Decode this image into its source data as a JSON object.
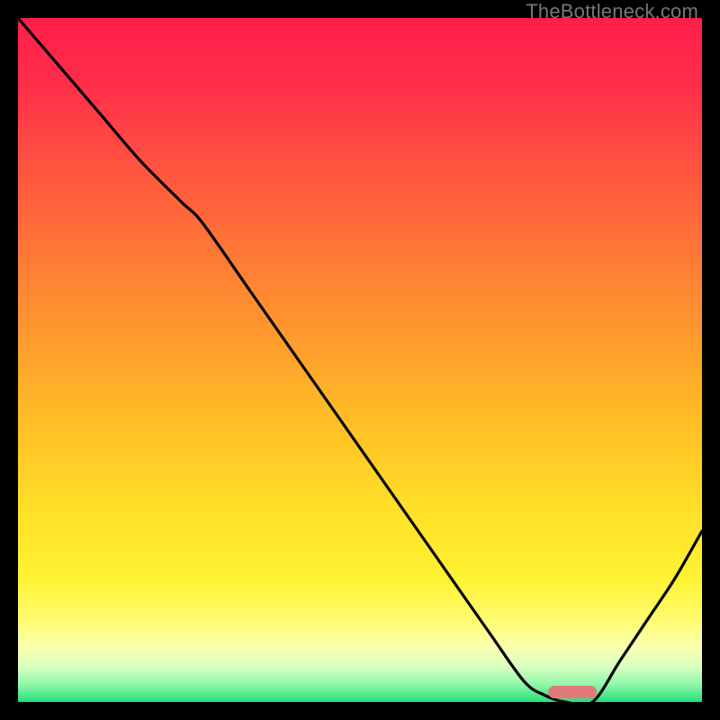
{
  "watermark": "TheBottleneck.com",
  "gradient_stops": [
    {
      "offset": 0.0,
      "color": "#ff1e4a"
    },
    {
      "offset": 0.1,
      "color": "#ff2f49"
    },
    {
      "offset": 0.22,
      "color": "#ff5440"
    },
    {
      "offset": 0.35,
      "color": "#ff7a36"
    },
    {
      "offset": 0.48,
      "color": "#ff9e2c"
    },
    {
      "offset": 0.6,
      "color": "#ffc126"
    },
    {
      "offset": 0.72,
      "color": "#ffe028"
    },
    {
      "offset": 0.82,
      "color": "#fff232"
    },
    {
      "offset": 0.88,
      "color": "#fffb70"
    },
    {
      "offset": 0.92,
      "color": "#fbffb0"
    },
    {
      "offset": 0.95,
      "color": "#d6ffc0"
    },
    {
      "offset": 0.975,
      "color": "#8ef7a8"
    },
    {
      "offset": 1.0,
      "color": "#22e07a"
    }
  ],
  "chart_data": {
    "type": "line",
    "title": "",
    "xlabel": "",
    "ylabel": "",
    "xlim": [
      0,
      100
    ],
    "ylim": [
      0,
      100
    ],
    "grid": false,
    "legend": null,
    "series": [
      {
        "name": "bottleneck-curve",
        "x": [
          0,
          6,
          12,
          18,
          24,
          27,
          34,
          41,
          48,
          55,
          62,
          69,
          74,
          77,
          80,
          84,
          88,
          92,
          96,
          100
        ],
        "y": [
          100,
          93,
          86,
          79,
          73,
          70,
          60,
          50,
          40,
          30,
          20,
          10,
          3,
          1,
          0,
          0,
          6,
          12,
          18,
          25
        ]
      }
    ],
    "annotations": [
      {
        "name": "optimal-marker",
        "x": 81,
        "y": 1.5,
        "shape": "pill",
        "color": "#e07a7a"
      }
    ]
  }
}
